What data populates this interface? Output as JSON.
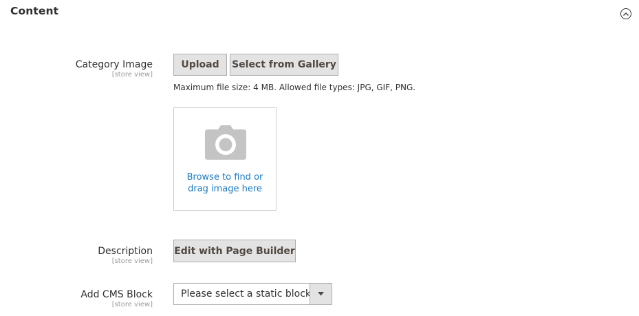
{
  "section": {
    "title": "Content",
    "collapse_icon": "chevron-up-circle-icon"
  },
  "fields": {
    "category_image": {
      "label": "Category Image",
      "scope": "[store view]",
      "upload_label": "Upload",
      "gallery_label": "Select from Gallery",
      "note": "Maximum file size: 4 MB. Allowed file types: JPG, GIF, PNG.",
      "dropzone_icon": "camera-icon",
      "dropzone_line1": "Browse to find or",
      "dropzone_line2": "drag image here"
    },
    "description": {
      "label": "Description",
      "scope": "[store view]",
      "button_label": "Edit with Page Builder"
    },
    "cms_block": {
      "label": "Add CMS Block",
      "scope": "[store view]",
      "selected": "Please select a static block.",
      "arrow_icon": "caret-down-icon"
    }
  },
  "colors": {
    "link": "#1979c3",
    "button_bg": "#e3e3e3",
    "button_border": "#adadad",
    "icon_gray": "#c4c4c4"
  }
}
